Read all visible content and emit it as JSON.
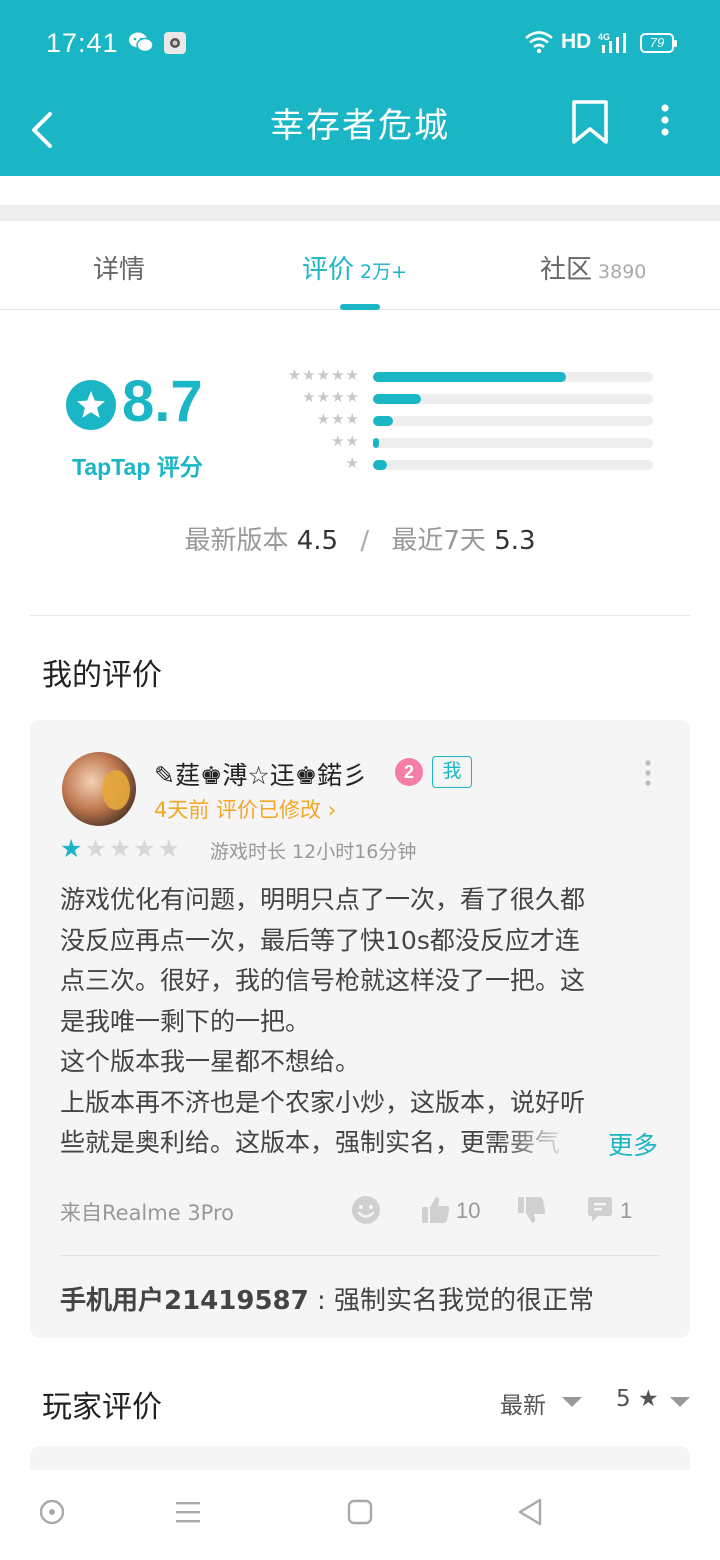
{
  "status_bar": {
    "time": "17:41",
    "network": "HD",
    "signal_label": "4G",
    "battery": "79",
    "icons": [
      "wechat-icon",
      "camera-notification-icon",
      "wifi-icon",
      "signal-icon",
      "battery-icon"
    ]
  },
  "header": {
    "title": "幸存者危城",
    "icons": [
      "back-icon",
      "bookmark-icon",
      "more-vertical-icon"
    ]
  },
  "colors": {
    "accent": "#1bb6c6",
    "highlight": "#f5a623",
    "level_badge": "#f47fa5"
  },
  "tabs": [
    {
      "label": "详情",
      "count": ""
    },
    {
      "label": "评价",
      "count": "2万+",
      "active": true
    },
    {
      "label": "社区",
      "count": "3890"
    }
  ],
  "rating": {
    "score": "8.7",
    "label": "TapTap 评分",
    "distribution": [
      {
        "stars": "★★★★★",
        "share": 0.69
      },
      {
        "stars": "★★★★",
        "share": 0.17
      },
      {
        "stars": "★★★",
        "share": 0.07
      },
      {
        "stars": "★★",
        "share": 0.02
      },
      {
        "stars": "★",
        "share": 0.05
      }
    ],
    "latest_version_label": "最新版本",
    "latest_version_score": "4.5",
    "recent_label": "最近7天",
    "recent_score": "5.3"
  },
  "my_review": {
    "section_title": "我的评价",
    "username": "✎莛♚溥☆迋♚鍩彡",
    "level": "2",
    "me_badge": "我",
    "meta": "4天前  评价已修改 ›",
    "stars": 1,
    "playtime": "游戏时长 12小时16分钟",
    "body_lines": [
      "游戏优化有问题，明明只点了一次，看了很久都",
      "没反应再点一次，最后等了快10s都没反应才连",
      "点三次。很好，我的信号枪就这样没了一把。这",
      "是我唯一剩下的一把。",
      "这个版本我一星都不想给。",
      "上版本再不济也是个农家小炒，这版本，说好听",
      "些就是奥利给。这版本，强制实名，更需要气"
    ],
    "more_label": "更多",
    "device": "来自Realme 3Pro",
    "likes": "10",
    "comments": "1",
    "reply_user": "手机用户21419587",
    "reply_text": " : 强制实名我觉的很正常"
  },
  "player_reviews": {
    "section_title": "玩家评价",
    "sort": "最新",
    "star_filter": "5 ★"
  }
}
